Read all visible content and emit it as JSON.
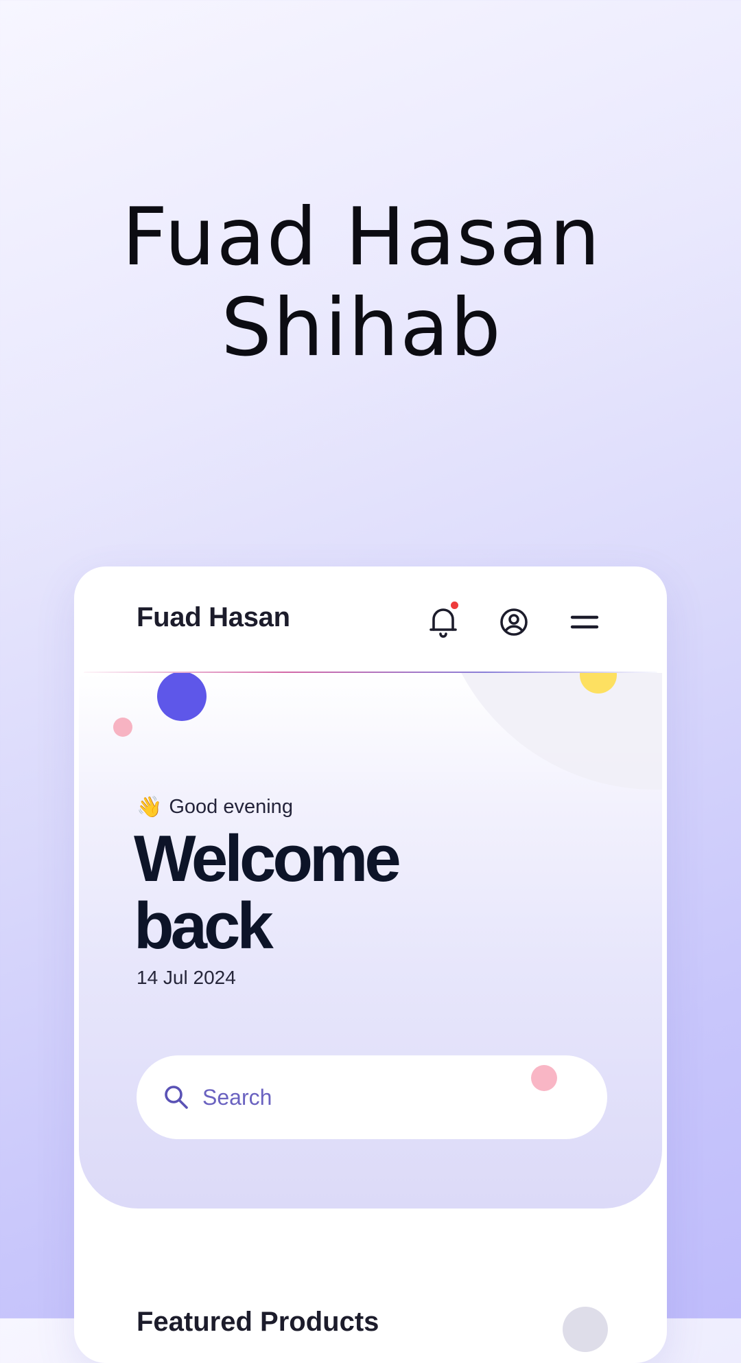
{
  "hero": {
    "title_line1": "Fuad Hasan",
    "title_line2": "Shihab"
  },
  "app": {
    "brand": "Fuad Hasan",
    "icons": {
      "notifications": "bell-icon",
      "profile": "user-circle-icon",
      "menu": "hamburger-menu-icon"
    },
    "notification_dot": true,
    "colors": {
      "accent": "#5e57e9",
      "notify": "#ee3b3b",
      "pink": "#f7b3c2",
      "yellow": "#fde061",
      "headline": "#0d1428",
      "search_text": "#6a62c0"
    }
  },
  "greeting": {
    "emoji": "👋",
    "text": "Good evening",
    "headline": "Welcome back",
    "date": "14 Jul 2024"
  },
  "search": {
    "placeholder": "Search",
    "value": ""
  },
  "section": {
    "title": "Featured Products"
  }
}
